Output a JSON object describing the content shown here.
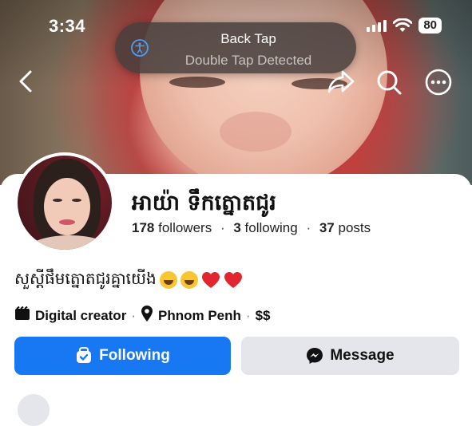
{
  "status_bar": {
    "time": "3:34",
    "battery": "80",
    "signal_icon": "cellular-signal-icon",
    "wifi_icon": "wifi-icon"
  },
  "toast": {
    "title": "Back Tap",
    "subtitle": "Double Tap Detected",
    "icon": "accessibility-icon"
  },
  "top_actions": {
    "back": "chevron-left-icon",
    "share": "share-icon",
    "search": "search-icon",
    "more": "more-icon"
  },
  "profile": {
    "name": "អាយ៉ា ទឹកត្នោតជូរ",
    "followers_count": "178",
    "followers_label": "followers",
    "following_count": "3",
    "following_label": "following",
    "posts_count": "37",
    "posts_label": "posts",
    "separator": "·",
    "bio": "សួស្តីផឹមត្នោតជូរគ្នាយើង",
    "category": "Digital creator",
    "location": "Phnom Penh",
    "price": "$$"
  },
  "buttons": {
    "following_label": "Following",
    "message_label": "Message"
  },
  "colors": {
    "primary": "#1877f2",
    "secondary_button": "#e4e6eb",
    "heart": "#e0262f"
  }
}
